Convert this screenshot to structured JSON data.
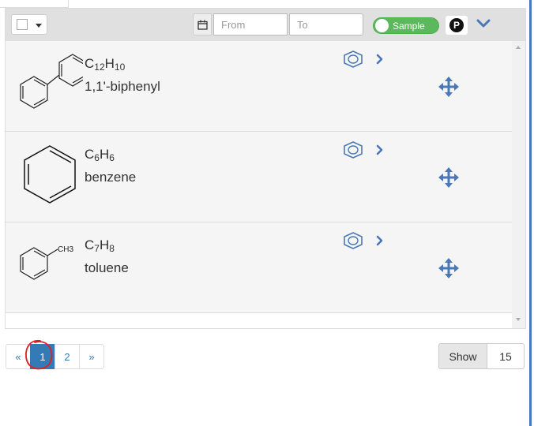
{
  "toolbar": {
    "from_placeholder": "From",
    "to_placeholder": "To",
    "sample_toggle_label": "Sample",
    "p_badge": "P",
    "accent_color": "#337ab7",
    "toggle_color": "#5cb85c"
  },
  "samples": [
    {
      "formula_base": [
        "C",
        "H"
      ],
      "formula_sub": [
        "12",
        "10"
      ],
      "name": "1,1'-biphenyl",
      "structure_icon": "biphenyl-structure"
    },
    {
      "formula_base": [
        "C",
        "H"
      ],
      "formula_sub": [
        "6",
        "6"
      ],
      "name": "benzene",
      "structure_icon": "benzene-structure"
    },
    {
      "formula_base": [
        "C",
        "H"
      ],
      "formula_sub": [
        "7",
        "8"
      ],
      "name": "toluene",
      "structure_icon": "toluene-structure",
      "structure_label": "CH3"
    }
  ],
  "pagination": {
    "prev": "«",
    "pages": [
      "1",
      "2"
    ],
    "next": "»",
    "current": "1"
  },
  "show": {
    "label": "Show",
    "count": "15"
  }
}
